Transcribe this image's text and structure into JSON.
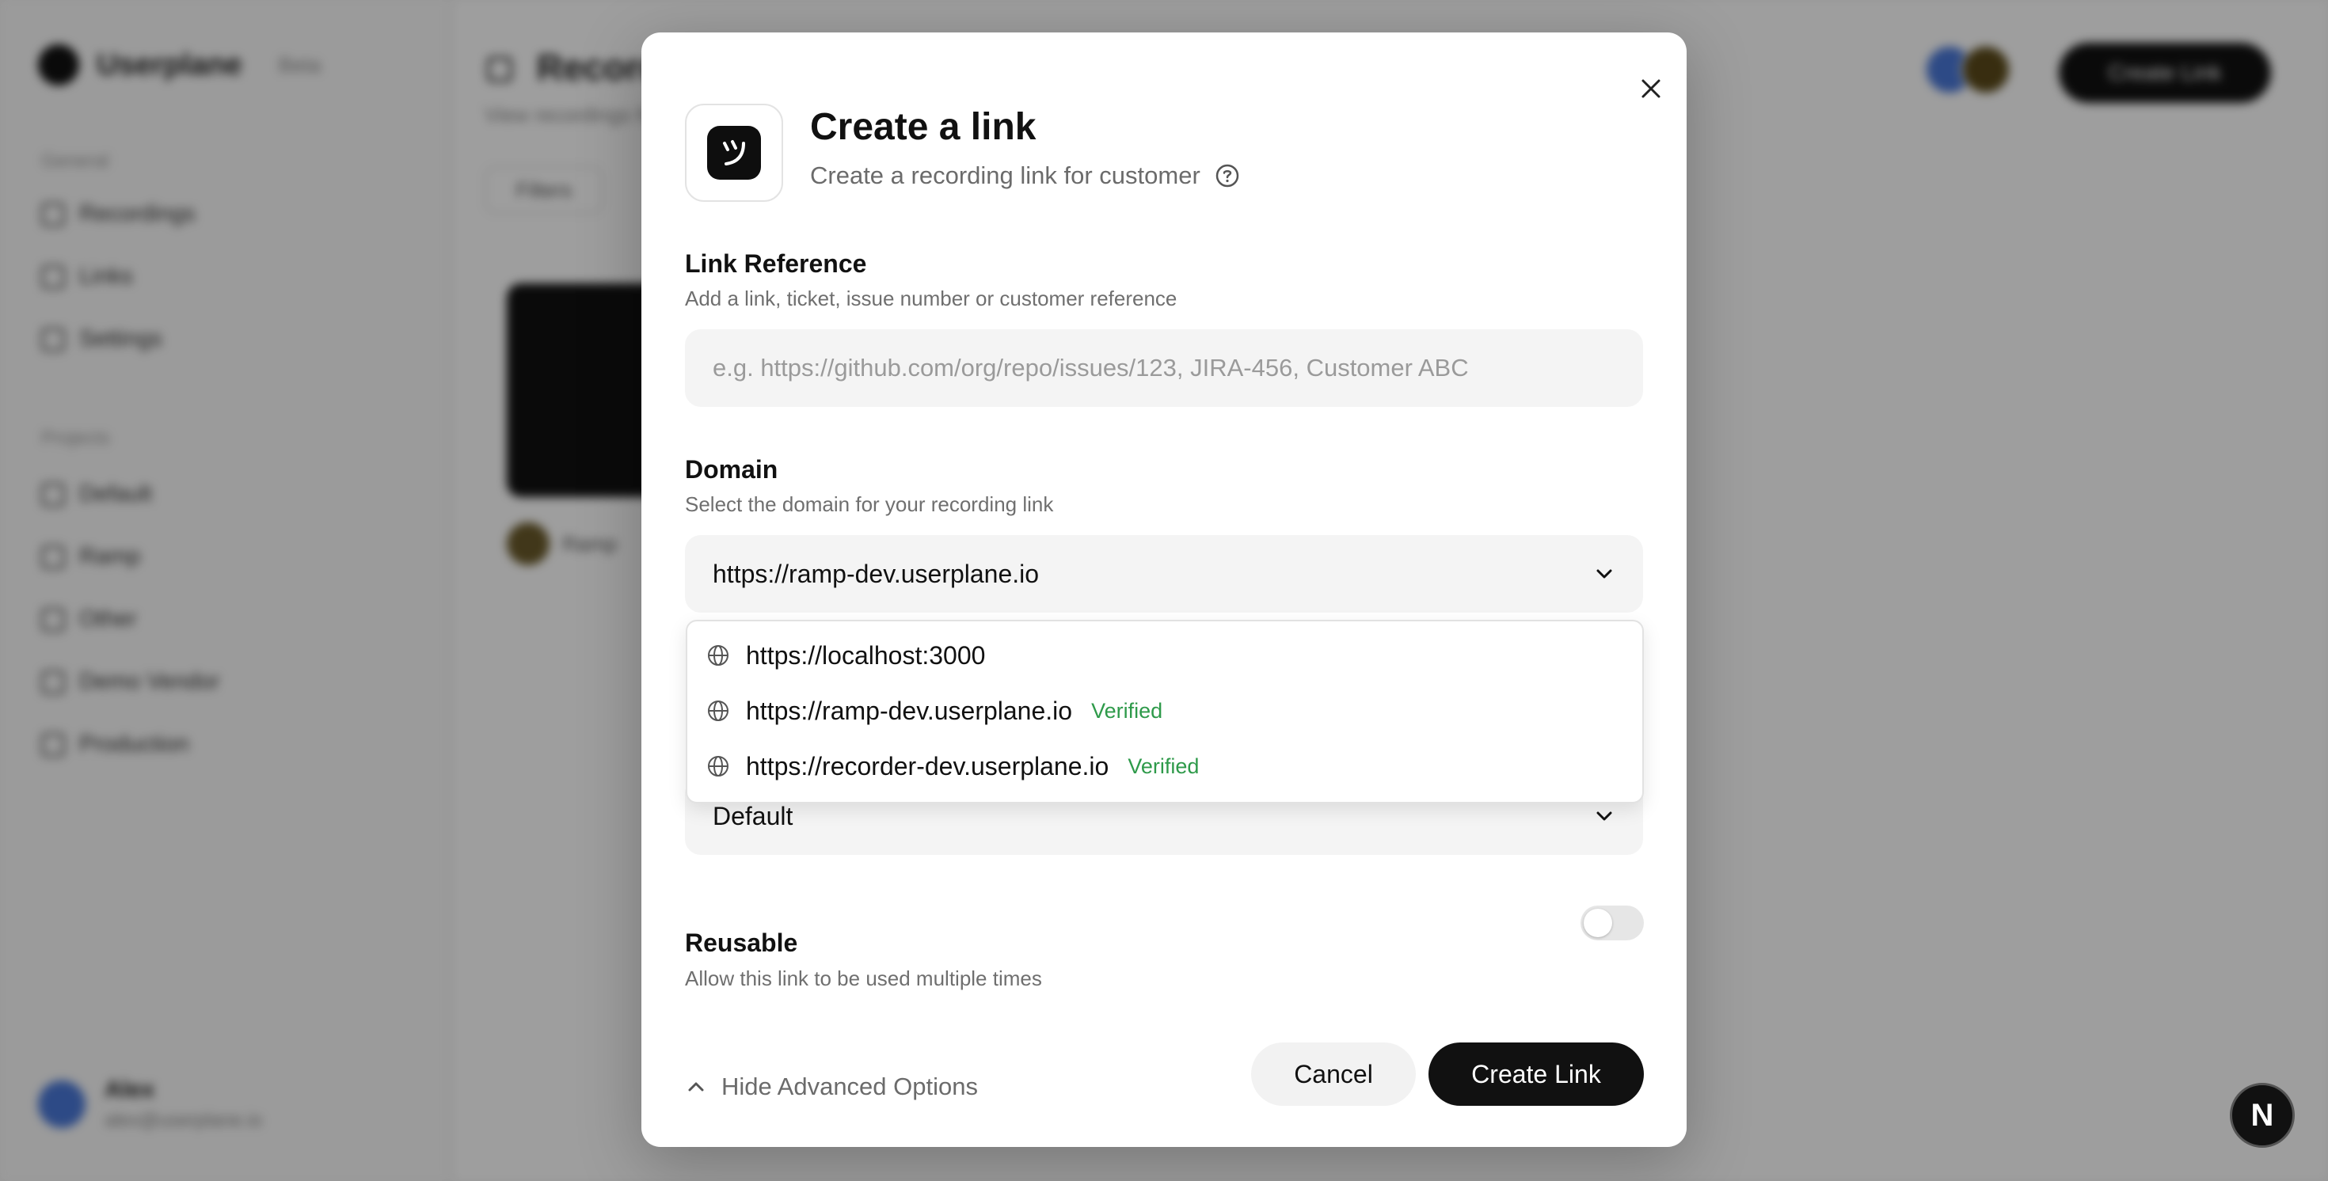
{
  "background": {
    "brand_name": "Userplane",
    "brand_tag": "Beta",
    "sections": [
      "General",
      "Projects"
    ],
    "nav_general": [
      "Recordings",
      "Links",
      "Settings"
    ],
    "nav_projects": [
      "Default",
      "Ramp",
      "Other",
      "Demo Vendor",
      "Production"
    ],
    "page_title": "Recordings",
    "page_sub": "View recordings from your customers",
    "filter_label": "Filters",
    "new_button": "Create Link",
    "user_name": "Alex",
    "user_email": "alex@userplane.io",
    "thumb_label": "Ramp"
  },
  "modal": {
    "title": "Create a link",
    "subtitle": "Create a recording link for customer",
    "link_reference": {
      "label": "Link Reference",
      "description": "Add a link, ticket, issue number or customer reference",
      "placeholder": "e.g. https://github.com/org/repo/issues/123, JIRA-456, Customer ABC",
      "value": ""
    },
    "domain": {
      "label": "Domain",
      "description": "Select the domain for your recording link",
      "selected": "https://ramp-dev.userplane.io",
      "options": [
        {
          "url": "https://localhost:3000",
          "badge": ""
        },
        {
          "url": "https://ramp-dev.userplane.io",
          "badge": "Verified"
        },
        {
          "url": "https://recorder-dev.userplane.io",
          "badge": "Verified"
        }
      ]
    },
    "project_select": {
      "selected": "Default"
    },
    "reusable": {
      "label": "Reusable",
      "description": "Allow this link to be used multiple times",
      "enabled": false
    },
    "advanced_toggle": "Hide Advanced Options",
    "cancel": "Cancel",
    "create": "Create Link"
  },
  "dev_badge": "N",
  "colors": {
    "primary": "#111111",
    "verified": "#2e9a4a",
    "overlay": "rgba(0,0,0,0.38)"
  }
}
